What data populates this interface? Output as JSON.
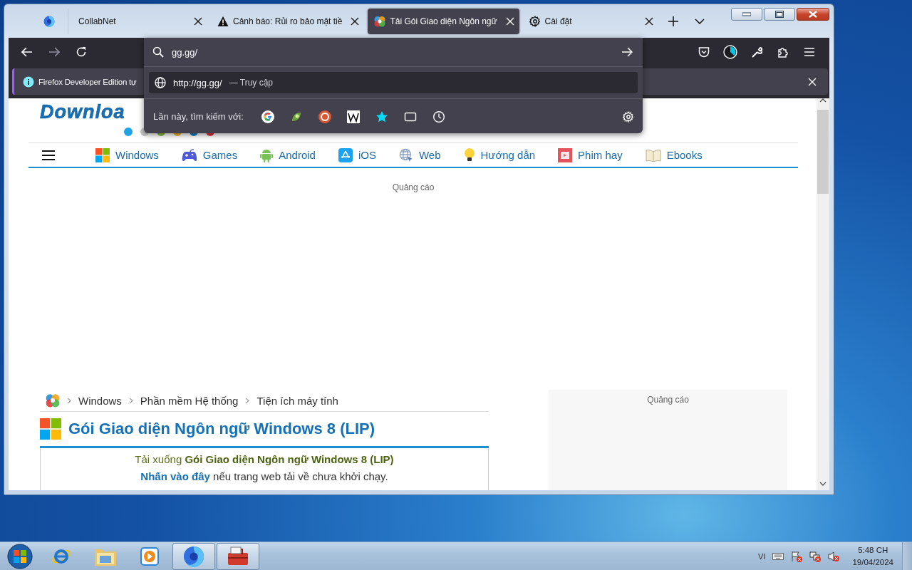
{
  "browser": {
    "tabs": [
      {
        "kind": "pinned",
        "selected": false
      },
      {
        "kind": "plain",
        "label": "CollabNet",
        "selected": false
      },
      {
        "kind": "warning",
        "label": "Cảnh báo: Rủi ro bảo mật tiề",
        "selected": false
      },
      {
        "kind": "swirl",
        "label": "Tải Gói Giao diện Ngôn ngữ",
        "selected": true
      },
      {
        "kind": "settings",
        "label": "Cài đặt",
        "selected": false
      }
    ],
    "nav_buttons": [
      {
        "kind": "back",
        "disabled": false
      },
      {
        "kind": "forward",
        "disabled": true
      },
      {
        "kind": "reload",
        "disabled": false
      }
    ],
    "notification": {
      "text": "Firefox Developer Edition tự"
    }
  },
  "url_popup": {
    "value": "gg.gg/",
    "result": {
      "url": "http://gg.gg/",
      "separator": "—",
      "action": "Truy cập"
    },
    "search_label": "Lần này, tìm kiếm với:",
    "engines": [
      {
        "kind": "google"
      },
      {
        "kind": "leaf"
      },
      {
        "kind": "duck"
      },
      {
        "kind": "wiki"
      },
      {
        "kind": "star"
      },
      {
        "kind": "tabs"
      },
      {
        "kind": "history"
      }
    ]
  },
  "site": {
    "logo": "Downloa",
    "nav": [
      {
        "kind": "windows",
        "label": "Windows"
      },
      {
        "kind": "games",
        "label": "Games"
      },
      {
        "kind": "android",
        "label": "Android"
      },
      {
        "kind": "ios",
        "label": "iOS"
      },
      {
        "kind": "web",
        "label": "Web"
      },
      {
        "kind": "guide",
        "label": "Hướng dẫn"
      },
      {
        "kind": "film",
        "label": "Phim hay"
      },
      {
        "kind": "book",
        "label": "Ebooks"
      }
    ],
    "ad_label": "Quảng cáo",
    "breadcrumb": [
      "Windows",
      "Phần mềm Hệ thống",
      "Tiện ích máy tính"
    ],
    "title": "Gói Giao diện Ngôn ngữ Windows 8 (LIP)",
    "download_line": "Tải xuống **Gói Giao diện Ngôn ngữ Windows 8 (LIP)**",
    "link": "Nhấn vào đây",
    "link_rest": "nếu trang web tải về chưa khởi chạy.",
    "side_ad_label": "Quảng cáo"
  },
  "taskbar": {
    "apps": [
      {
        "kind": "ie",
        "active": false
      },
      {
        "kind": "explorer",
        "active": false
      },
      {
        "kind": "media",
        "active": false
      },
      {
        "kind": "firefox",
        "active": true
      },
      {
        "kind": "toolbox",
        "active": true
      }
    ],
    "language": "VI",
    "time": "5:48 CH",
    "date": "19/04/2024"
  }
}
